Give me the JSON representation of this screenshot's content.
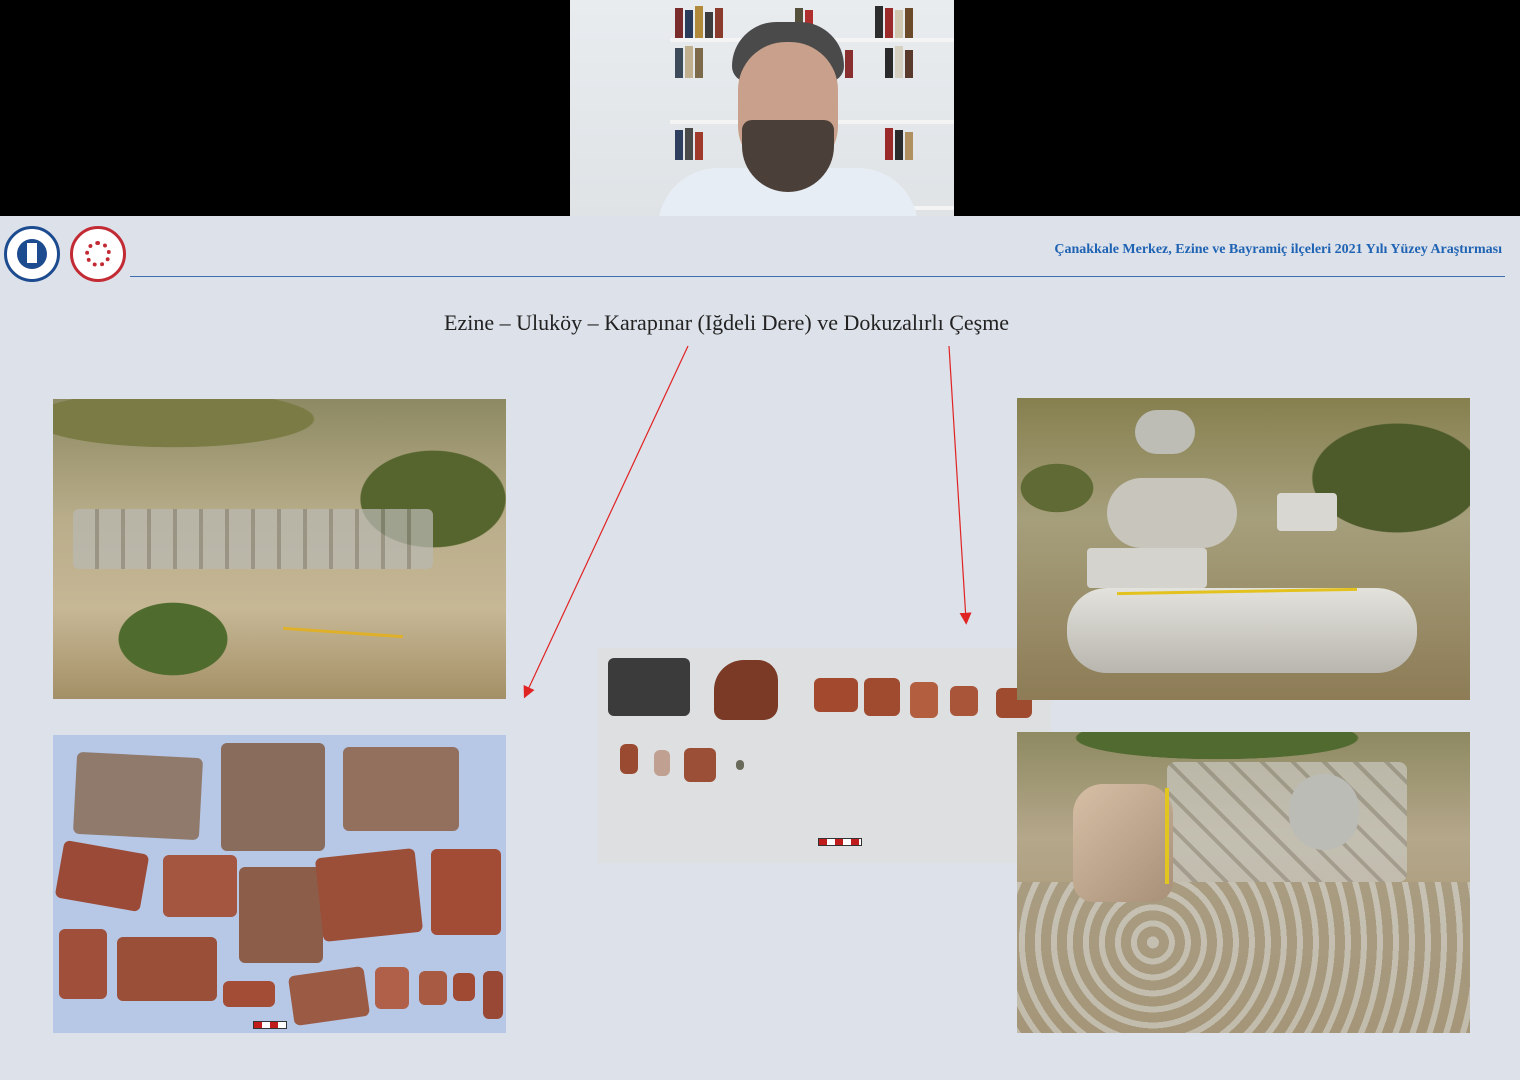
{
  "slide": {
    "header_title": "Çanakkale Merkez, Ezine ve Bayramiç ilçeleri 2021 Yılı Yüzey Araştırması",
    "main_title": "Ezine – Uluköy – Karapınar (Iğdeli Dere) ve Dokuzalırlı Çeşme"
  },
  "colors": {
    "header_title": "#1f63b4",
    "header_rule": "#3e6fb2",
    "arrow": "#e02323",
    "slide_background": "#dde1e9"
  },
  "icons": {
    "logo_left": "university-seal-icon",
    "logo_right": "ministry-emblem-icon"
  }
}
